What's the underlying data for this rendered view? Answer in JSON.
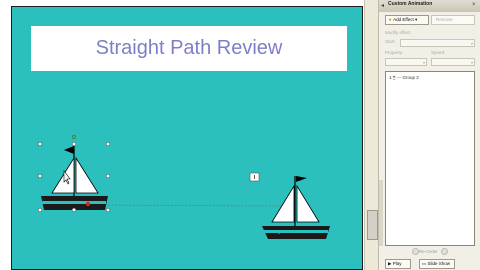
{
  "slide": {
    "title": "Straight Path Review"
  },
  "pane": {
    "title": "Custom Animation",
    "add_effect": "Add Effect",
    "remove": "Remove",
    "modify_label": "Modify effect",
    "start_label": "Start:",
    "property_label": "Property:",
    "speed_label": "Speed:",
    "list_item": {
      "index": "1",
      "name": "Group 2"
    },
    "reorder": "Re-Order",
    "play": "Play",
    "slide_show": "Slide Show"
  },
  "colors": {
    "slide_bg": "#2bbfbe",
    "title_text": "#7e7ec8",
    "hull": "#1a1a1a",
    "hull_stripe": "#2bbfbe"
  },
  "icons": [
    "star-icon",
    "play-icon",
    "slideshow-icon",
    "mouse-icon",
    "close-icon",
    "arrow-icon"
  ]
}
